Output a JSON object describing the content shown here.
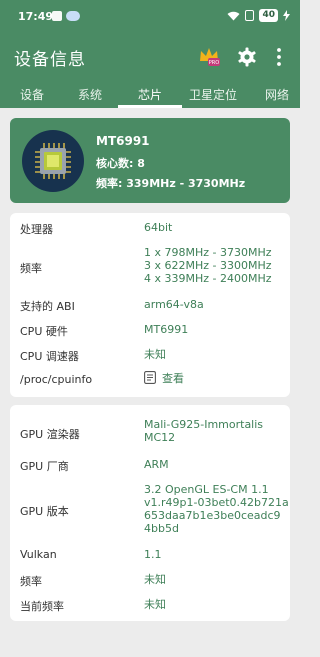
{
  "status_bar": {
    "time": "17:49",
    "battery": "40"
  },
  "app_bar": {
    "title": "设备信息",
    "crown_badge": "PRO"
  },
  "tabs": [
    {
      "label": "设备"
    },
    {
      "label": "系统"
    },
    {
      "label": "芯片",
      "active": true
    },
    {
      "label": "卫星定位"
    },
    {
      "label": "网络"
    }
  ],
  "cpu_summary": {
    "model": "MT6991",
    "cores_label": "核心数: 8",
    "freq_label": "频率: 339MHz - 3730MHz"
  },
  "cpu_info": {
    "processor": {
      "label": "处理器",
      "value": "64bit"
    },
    "frequency": {
      "label": "频率",
      "lines": [
        "1 x 798MHz - 3730MHz",
        "3 x 622MHz - 3300MHz",
        "4 x 339MHz - 2400MHz"
      ]
    },
    "abi": {
      "label": "支持的 ABI",
      "value": "arm64-v8a"
    },
    "hardware": {
      "label": "CPU 硬件",
      "value": "MT6991"
    },
    "governor": {
      "label": "CPU 调速器",
      "value": "未知"
    },
    "cpuinfo": {
      "label": "/proc/cpuinfo",
      "value": "查看"
    }
  },
  "gpu_info": {
    "renderer": {
      "label": "GPU 渲染器",
      "lines": [
        "Mali-G925-Immortalis",
        "MC12"
      ]
    },
    "vendor": {
      "label": "GPU 厂商",
      "value": "ARM"
    },
    "version": {
      "label": "GPU 版本",
      "lines": [
        "3.2 OpenGL ES-CM 1.1",
        "v1.r49p1-03bet0.42b721a",
        "653daa7b1e3be0ceadc9",
        "4bb5d"
      ]
    },
    "vulkan": {
      "label": "Vulkan",
      "value": "1.1"
    },
    "frequency": {
      "label": "频率",
      "value": "未知"
    },
    "current_frequency": {
      "label": "当前频率",
      "value": "未知"
    }
  },
  "colors": {
    "primary": "#4a8b64",
    "value_text": "#3e7f57",
    "background": "#ececec"
  }
}
